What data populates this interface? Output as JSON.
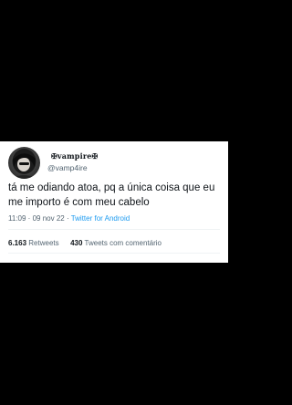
{
  "tweet": {
    "display_name": "✠vampire✠",
    "username": "@vamp4ire",
    "text": "tá me odiando atoa, pq a única coisa que eu me importo é com meu cabelo",
    "time": "11:09",
    "date": "09 nov 22",
    "separator": "·",
    "source": "Twitter for Android",
    "retweets_count": "6.163",
    "retweets_label": "Retweets",
    "quotes_count": "430",
    "quotes_label": "Tweets com comentário"
  },
  "colors": {
    "page_background": "#000000",
    "card_background": "#ffffff",
    "text_primary": "#0f1419",
    "text_secondary": "#536471",
    "link": "#1d9bf0"
  },
  "icons": {
    "avatar": "profile-photo-dark-hair"
  }
}
